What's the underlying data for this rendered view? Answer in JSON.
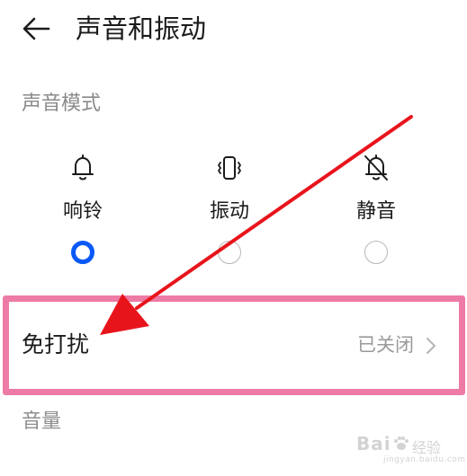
{
  "header": {
    "back_icon": "back-arrow-icon",
    "title": "声音和振动"
  },
  "sound_mode": {
    "section_title": "声音模式",
    "options": [
      {
        "label": "响铃",
        "icon": "bell-icon",
        "selected": true
      },
      {
        "label": "振动",
        "icon": "vibrate-icon",
        "selected": false
      },
      {
        "label": "静音",
        "icon": "bell-off-icon",
        "selected": false
      }
    ]
  },
  "do_not_disturb": {
    "label": "免打扰",
    "status": "已关闭",
    "icon": "chevron-right-icon"
  },
  "volume": {
    "section_title": "音量"
  },
  "watermark": {
    "brand": "Bai",
    "sub": "经验",
    "domain": "jingyan.baidu.com"
  },
  "colors": {
    "accent": "#0a59f7",
    "highlight_border": "#ee7aa6",
    "annotation_arrow": "#e8141c"
  }
}
